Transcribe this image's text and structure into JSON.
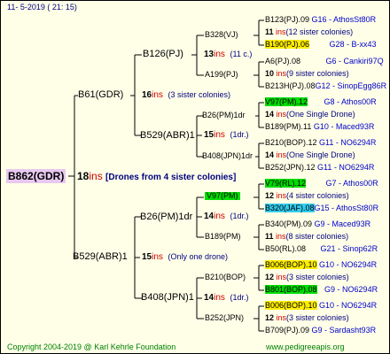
{
  "header": "11-  5-2019 (  21: 15)",
  "footer_left": "Copyright 2004-2019 @ Karl Kehrle Foundation",
  "footer_right": "www.pedigreeapis.org",
  "root": {
    "name": "B862(GDR)",
    "num": "18",
    "ins": "ins",
    "note": "[Drones from 4 sister colonies]"
  },
  "g1": [
    {
      "name": "B61(GDR)",
      "num": "16",
      "ins": "ins",
      "note": "(3 sister colonies)"
    },
    {
      "name": "B529(ABR)1",
      "num": "15",
      "ins": "ins",
      "note": "(Only one drone)"
    }
  ],
  "g2": [
    {
      "name": "B126(PJ)",
      "num": "13",
      "ins": "ins",
      "note": "(11 c.)"
    },
    {
      "name": "B529(ABR)1",
      "num": "15",
      "ins": "ins",
      "note": "(1dr.)"
    },
    {
      "name": "B26(PM)1dr",
      "num": "14",
      "ins": "ins",
      "note": "(1dr.)"
    },
    {
      "name": "B408(JPN)1",
      "num": "14",
      "ins": "ins",
      "note": "(1dr.)"
    }
  ],
  "g3": [
    {
      "name": "B328(VJ)",
      "num": "11",
      "ins": "ins",
      "note": "(12 sister colonies)"
    },
    {
      "name": "A199(PJ)"
    },
    {
      "name": "B26(PM)1dr",
      "num": "14",
      "ins": "ins",
      "note": "(One Single Drone)"
    },
    {
      "name": "B408(JPN)1dr"
    },
    {
      "name": "V97(PM)"
    },
    {
      "name": "B189(PM)"
    },
    {
      "name": "B210(BOP)",
      "num": "12",
      "ins": "ins",
      "note": "(3 sister colonies)"
    },
    {
      "name": "B252(JPN)"
    }
  ],
  "g4": [
    {
      "name": "B123(PJ).09",
      "code": "G16 - AthosSt80R"
    },
    {
      "name": "B190(PJ).06",
      "code": "G28 - B-xx43"
    },
    {
      "name": "A6(PJ).08",
      "code": "G6 - Cankiri97Q"
    },
    {
      "name": "B213H(PJ).08",
      "code": "G12 - SinopEgg86R"
    },
    {
      "name": "V97(PM).12",
      "code": "G8 - Athos00R"
    },
    {
      "name": "B189(PM).11",
      "code": "G10 - Maced93R"
    },
    {
      "name": "B210(BOP).12",
      "code": "G11 - NO6294R"
    },
    {
      "name": "B252(JPN).12",
      "code": "G11 - NO6294R"
    },
    {
      "name": "V79(RL).12",
      "code": "G7 - Athos00R"
    },
    {
      "name": "B320(JAF).08",
      "code": "G15 - AthosSt80R"
    },
    {
      "name": "B340(PM).09",
      "code": "G9 - Maced93R"
    },
    {
      "name": "B50(RL).08",
      "code": "G21 - Sinop62R"
    },
    {
      "name": "B006(BOP).10",
      "code": "G10 - NO6294R"
    },
    {
      "name": "B801(BOP).08",
      "code": "G9 - NO6294R"
    },
    {
      "name": "B006(BOP).10",
      "code": "G10 - NO6294R"
    },
    {
      "name": "B709(PJ).09",
      "code": "G9 - Sardasht93R"
    }
  ],
  "g4_notes": [
    {
      "num": "11",
      "ins": "ins",
      "note": "(12 sister colonies)"
    },
    {
      "num": "10",
      "ins": "ins",
      "note": "(9 sister colonies)"
    },
    {
      "num": "14",
      "ins": "ins",
      "note": "(One Single Drone)"
    },
    {
      "num": "14",
      "ins": "ins",
      "note": "(One Single Drone)"
    },
    {
      "num": "12",
      "ins": "ins",
      "note": "(4 sister colonies)"
    },
    {
      "num": "11",
      "ins": "ins",
      "note": "(8 sister colonies)"
    },
    {
      "num": "12",
      "ins": "ins",
      "note": "(3 sister colonies)"
    },
    {
      "num": "12",
      "ins": "ins",
      "note": "(3 sister colonies)"
    }
  ],
  "colors": {
    "background": "#ffffe8",
    "green": "#00dd00",
    "yellow": "#ffee00",
    "cyan": "#33ccee",
    "ins_red": "#cc0000",
    "note_blue": "#000080"
  }
}
